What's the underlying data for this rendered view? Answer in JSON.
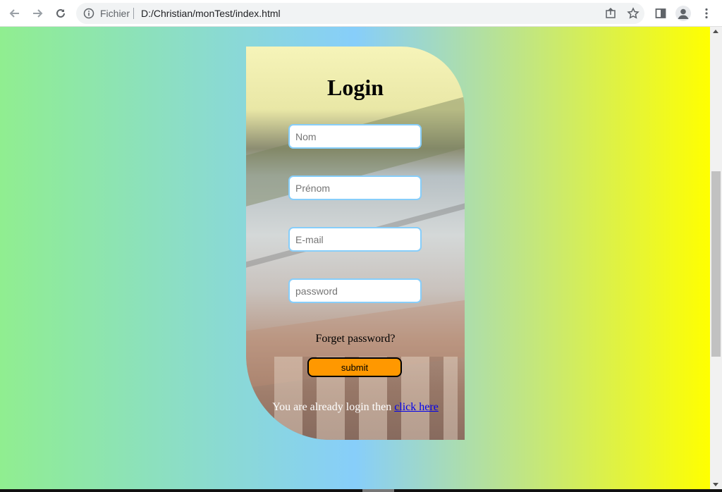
{
  "browser": {
    "scheme_label": "Fichier",
    "url": "D:/Christian/monTest/index.html"
  },
  "page": {
    "gradient_colors": [
      "#90ee90",
      "#87cefa",
      "#ffff00"
    ],
    "title": "Login",
    "fields": {
      "nom_placeholder": "Nom",
      "prenom_placeholder": "Prénom",
      "email_placeholder": "E-mail",
      "password_placeholder": "password"
    },
    "forget_label": "Forget password?",
    "submit_label": "submit",
    "submit_color": "#ff9800",
    "footer_text": "You are already login then",
    "footer_link": "click here"
  },
  "icons": [
    "back-arrow-icon",
    "forward-arrow-icon",
    "reload-icon",
    "info-icon",
    "share-icon",
    "star-icon",
    "sidebar-icon",
    "profile-icon",
    "menu-icon"
  ]
}
